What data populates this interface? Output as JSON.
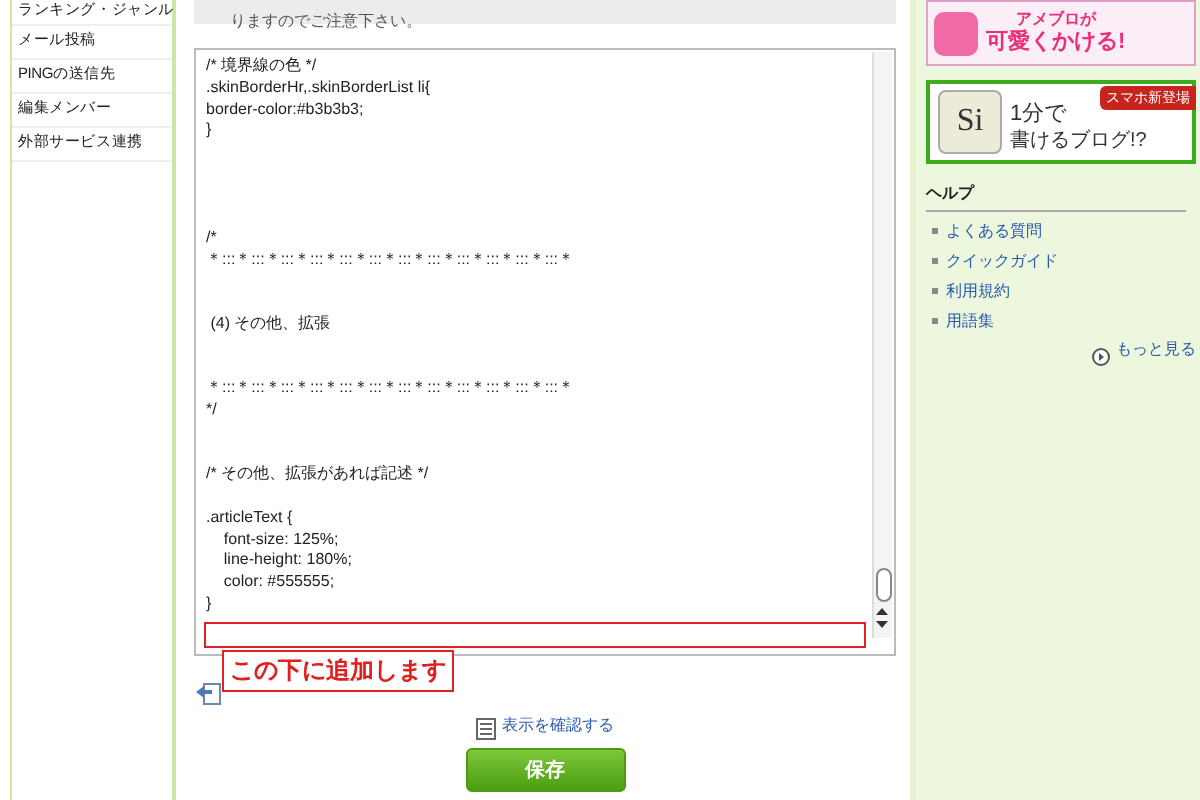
{
  "sidebar": {
    "items": [
      {
        "label": "ランキング・ジャンル"
      },
      {
        "label": "メール投稿"
      },
      {
        "label": "PINGの送信先"
      },
      {
        "label": "編集メンバー"
      },
      {
        "label": "外部サービス連携"
      }
    ]
  },
  "notice": {
    "text": "りますのでご注意下さい。"
  },
  "editor": {
    "lines": [
      {
        "kind": "text",
        "text": "/* 境界線の色 */"
      },
      {
        "kind": "text",
        "text": ".skinBorderHr,.skinBorderList li{"
      },
      {
        "kind": "text",
        "text": "border-color:#b3b3b3;"
      },
      {
        "kind": "text",
        "text": "}"
      },
      {
        "kind": "blank"
      },
      {
        "kind": "blank"
      },
      {
        "kind": "blank"
      },
      {
        "kind": "blank"
      },
      {
        "kind": "text",
        "text": "/*"
      },
      {
        "kind": "text",
        "text": "＊:::＊:::＊:::＊:::＊:::＊:::＊:::＊:::＊:::＊:::＊:::＊:::＊"
      },
      {
        "kind": "blank"
      },
      {
        "kind": "blank"
      },
      {
        "kind": "text",
        "text": " (4) その他、拡張"
      },
      {
        "kind": "blank"
      },
      {
        "kind": "blank"
      },
      {
        "kind": "text",
        "text": "＊:::＊:::＊:::＊:::＊:::＊:::＊:::＊:::＊:::＊:::＊:::＊:::＊"
      },
      {
        "kind": "text",
        "text": "*/"
      },
      {
        "kind": "blank"
      },
      {
        "kind": "blank"
      },
      {
        "kind": "text",
        "text": "/* その他、拡張があれば記述 */"
      },
      {
        "kind": "blank"
      },
      {
        "kind": "text",
        "text": ".articleText {"
      },
      {
        "kind": "text",
        "text": "    font-size: 125%;"
      },
      {
        "kind": "text",
        "text": "    line-height: 180%;"
      },
      {
        "kind": "text",
        "text": "    color: #555555;"
      },
      {
        "kind": "text",
        "text": "}"
      }
    ]
  },
  "annotation": {
    "text": "この下に追加します"
  },
  "preview_link": "表示を確認する",
  "save_button": "保存",
  "banners": [
    {
      "kind": "ameblo",
      "text": "アメブロが",
      "text2": "可愛くかける!"
    },
    {
      "kind": "si",
      "logo": "Si",
      "badge": "スマホ新登場",
      "text": "1分で",
      "text2": "書けるブログ!?"
    }
  ],
  "help": {
    "title": "ヘルプ",
    "items": [
      {
        "label": "よくある質問"
      },
      {
        "label": "クイックガイド"
      },
      {
        "label": "利用規約"
      },
      {
        "label": "用語集"
      }
    ],
    "more": "もっと見る"
  }
}
